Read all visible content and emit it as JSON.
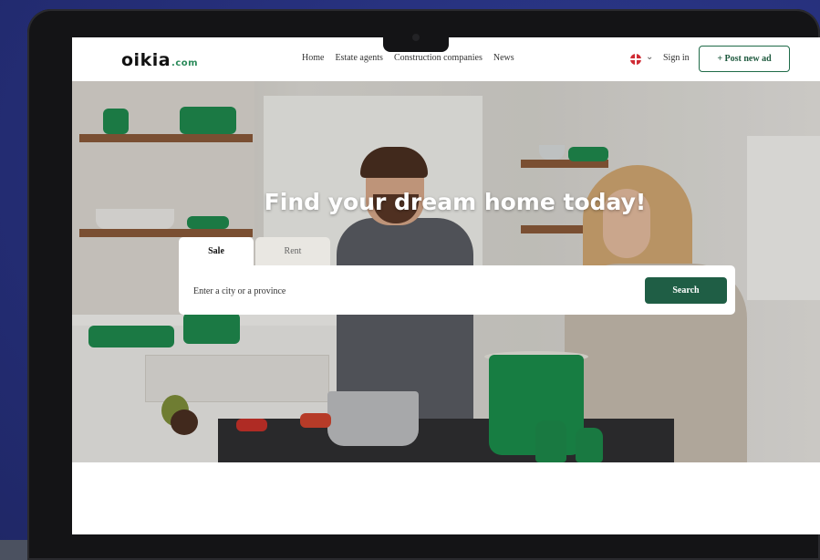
{
  "header": {
    "logo_text": "oikia",
    "logo_domain": ".com",
    "nav": [
      "Home",
      "Estate agents",
      "Construction companies",
      "News"
    ],
    "language_icon": "uk-flag-icon",
    "sign_in": "Sign in",
    "post_ad": "+ Post new ad"
  },
  "hero": {
    "title": "Find your dream home today!",
    "tabs": [
      {
        "label": "Sale",
        "active": true
      },
      {
        "label": "Rent",
        "active": false
      }
    ],
    "search": {
      "placeholder": "Enter a city or a province",
      "button": "Search"
    }
  },
  "colors": {
    "brand_green": "#1f5e45",
    "accent_green": "#1f8a4e",
    "background": "#27307a"
  }
}
